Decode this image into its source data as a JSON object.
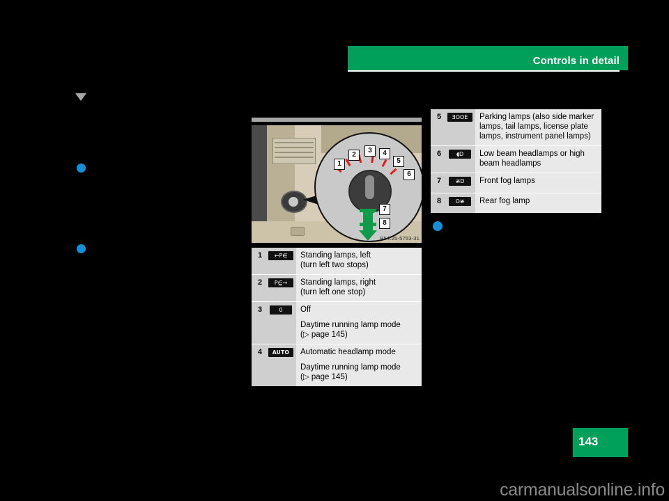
{
  "header": {
    "title": "Controls in detail"
  },
  "figure": {
    "caption_code": "P54.25-5753-31",
    "callouts": [
      "1",
      "2",
      "3",
      "4",
      "5",
      "6",
      "7",
      "8"
    ]
  },
  "table_upper": {
    "rows": [
      {
        "num": "5",
        "icon_name": "parking-lamps-icon",
        "icon_glyph": "ƎOOE",
        "text": "Parking lamps (also side marker lamps, tail lamps, license plate lamps, instrument panel lamps)"
      },
      {
        "num": "6",
        "icon_name": "low-beam-headlamps-icon",
        "icon_glyph": "◖D",
        "text": "Low beam headlamps or high beam headlamps"
      },
      {
        "num": "7",
        "icon_name": "front-fog-lamps-icon",
        "icon_glyph": "≇D",
        "text": "Front fog lamps"
      },
      {
        "num": "8",
        "icon_name": "rear-fog-lamp-icon",
        "icon_glyph": "O≇",
        "text": "Rear fog lamp"
      }
    ]
  },
  "table_lower": {
    "rows": [
      {
        "num": "1",
        "icon_name": "standing-lamps-left-icon",
        "icon_glyph": "←P⋹",
        "text": "Standing lamps, left",
        "subtext": "(turn left two stops)",
        "extra": "",
        "extra2": ""
      },
      {
        "num": "2",
        "icon_name": "standing-lamps-right-icon",
        "icon_glyph": "P⋸→",
        "text": "Standing lamps, right",
        "subtext": "(turn left one stop)",
        "extra": "",
        "extra2": ""
      },
      {
        "num": "3",
        "icon_name": "lights-off-icon",
        "icon_glyph": "0",
        "text": "Off",
        "subtext": "",
        "extra": "Daytime running lamp mode",
        "extra2": "(▷ page 145)"
      },
      {
        "num": "4",
        "icon_name": "automatic-headlamp-icon",
        "icon_glyph": "AUTO",
        "text": "Automatic headlamp mode",
        "subtext": "",
        "extra": "Daytime running lamp mode",
        "extra2": "(▷ page 145)"
      }
    ]
  },
  "page_number": "143",
  "watermark": "carmanualsonline.info",
  "colors": {
    "brand_green": "#00A05A",
    "bullet_blue": "#1590D8",
    "table_bg": "#e9e9e9",
    "table_num_bg": "#cfcfcf",
    "marker_grey": "#A6A6A6"
  }
}
